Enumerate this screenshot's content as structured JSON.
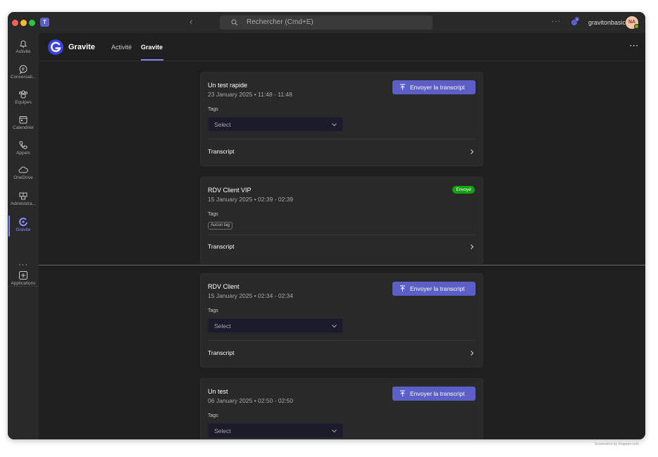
{
  "titlebar": {
    "search_placeholder": "Rechercher (Cmd+E)",
    "more": "···",
    "user_name": "gravitonbasic",
    "avatar_initials": "NA",
    "notification_count": "1"
  },
  "rail": {
    "items": [
      {
        "label": "Activité",
        "icon": "bell-icon"
      },
      {
        "label": "Conversati...",
        "icon": "chat-icon"
      },
      {
        "label": "Équipes",
        "icon": "teams-icon"
      },
      {
        "label": "Calendrier",
        "icon": "calendar-icon"
      },
      {
        "label": "Appels",
        "icon": "phone-icon"
      },
      {
        "label": "OneDrive",
        "icon": "cloud-icon"
      },
      {
        "label": "Administra...",
        "icon": "admin-icon"
      },
      {
        "label": "Gravite",
        "icon": "gravite-icon"
      }
    ],
    "more": "···",
    "apps_label": "Applications"
  },
  "appbar": {
    "app_name": "Gravite",
    "tabs": [
      "Activité",
      "Gravite"
    ],
    "active_tab": "Gravite",
    "more": "···"
  },
  "colors": {
    "accent": "#5b5fc7",
    "active_nav": "#7f85f5",
    "sent_badge": "#13a10e",
    "background": "#1f1f1f",
    "card": "#292929"
  },
  "meetings": [
    {
      "title": "Un test rapide",
      "date": "23 January 2025 • 11:48 - 11:48",
      "action_label": "Envoyer la transcript",
      "tags_label": "Tags",
      "tags_select": "Select",
      "transcript_label": "Transcript"
    },
    {
      "title": "RDV Client VIP",
      "date": "15 January 2025 • 02:39 - 02:39",
      "status": "Envoyé",
      "tags_label": "Tags",
      "tags_empty": "Aucun tag",
      "transcript_label": "Transcript"
    },
    {
      "title": "RDV Client",
      "date": "15 January 2025 • 02:34 - 02:34",
      "action_label": "Envoyer la transcript",
      "tags_label": "Tags",
      "tags_select": "Select",
      "transcript_label": "Transcript"
    },
    {
      "title": "Un test",
      "date": "06 January 2025 • 02:50 - 02:50",
      "action_label": "Envoyer la transcript",
      "tags_label": "Tags",
      "tags_select": "Select"
    }
  ],
  "caption": "Screenshot by Xnapper.com"
}
